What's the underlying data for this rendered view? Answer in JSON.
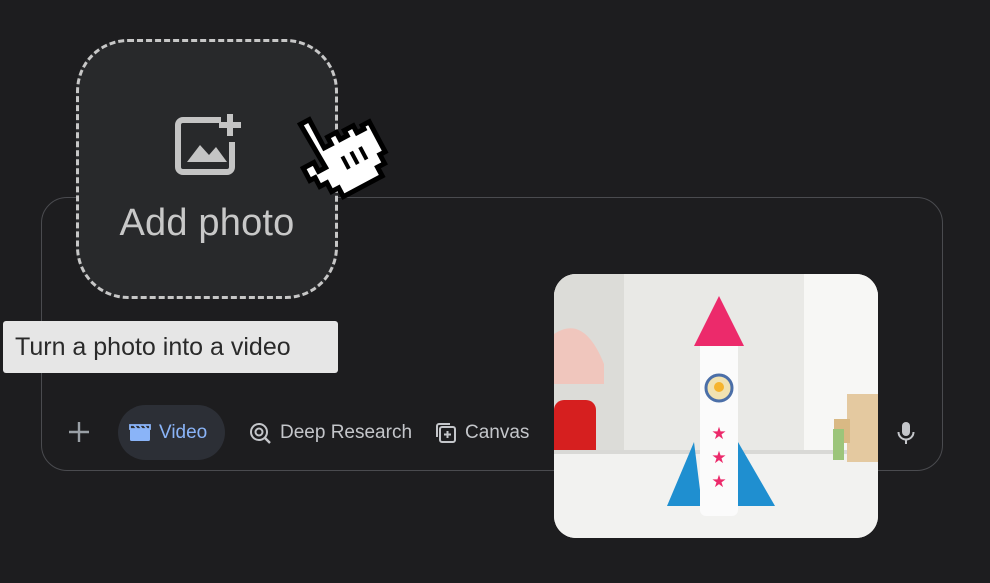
{
  "add_photo": {
    "label": "Add photo",
    "icon": "add-photo-icon"
  },
  "tooltip": {
    "text": "Turn a photo into a video"
  },
  "toolbar": {
    "add_icon": "plus-icon",
    "chips": [
      {
        "label": "Video",
        "icon": "video-clapper-icon",
        "selected": true
      },
      {
        "label": "Deep Research",
        "icon": "deep-research-icon"
      },
      {
        "label": "Canvas",
        "icon": "canvas-icon"
      }
    ],
    "mic_icon": "microphone-icon"
  },
  "cursor": {
    "icon": "hand-pointer-cursor-icon"
  },
  "colors": {
    "background": "#1d1d1f",
    "accent": "#8ab4f8",
    "chip_selected_bg": "#2c2f36"
  }
}
